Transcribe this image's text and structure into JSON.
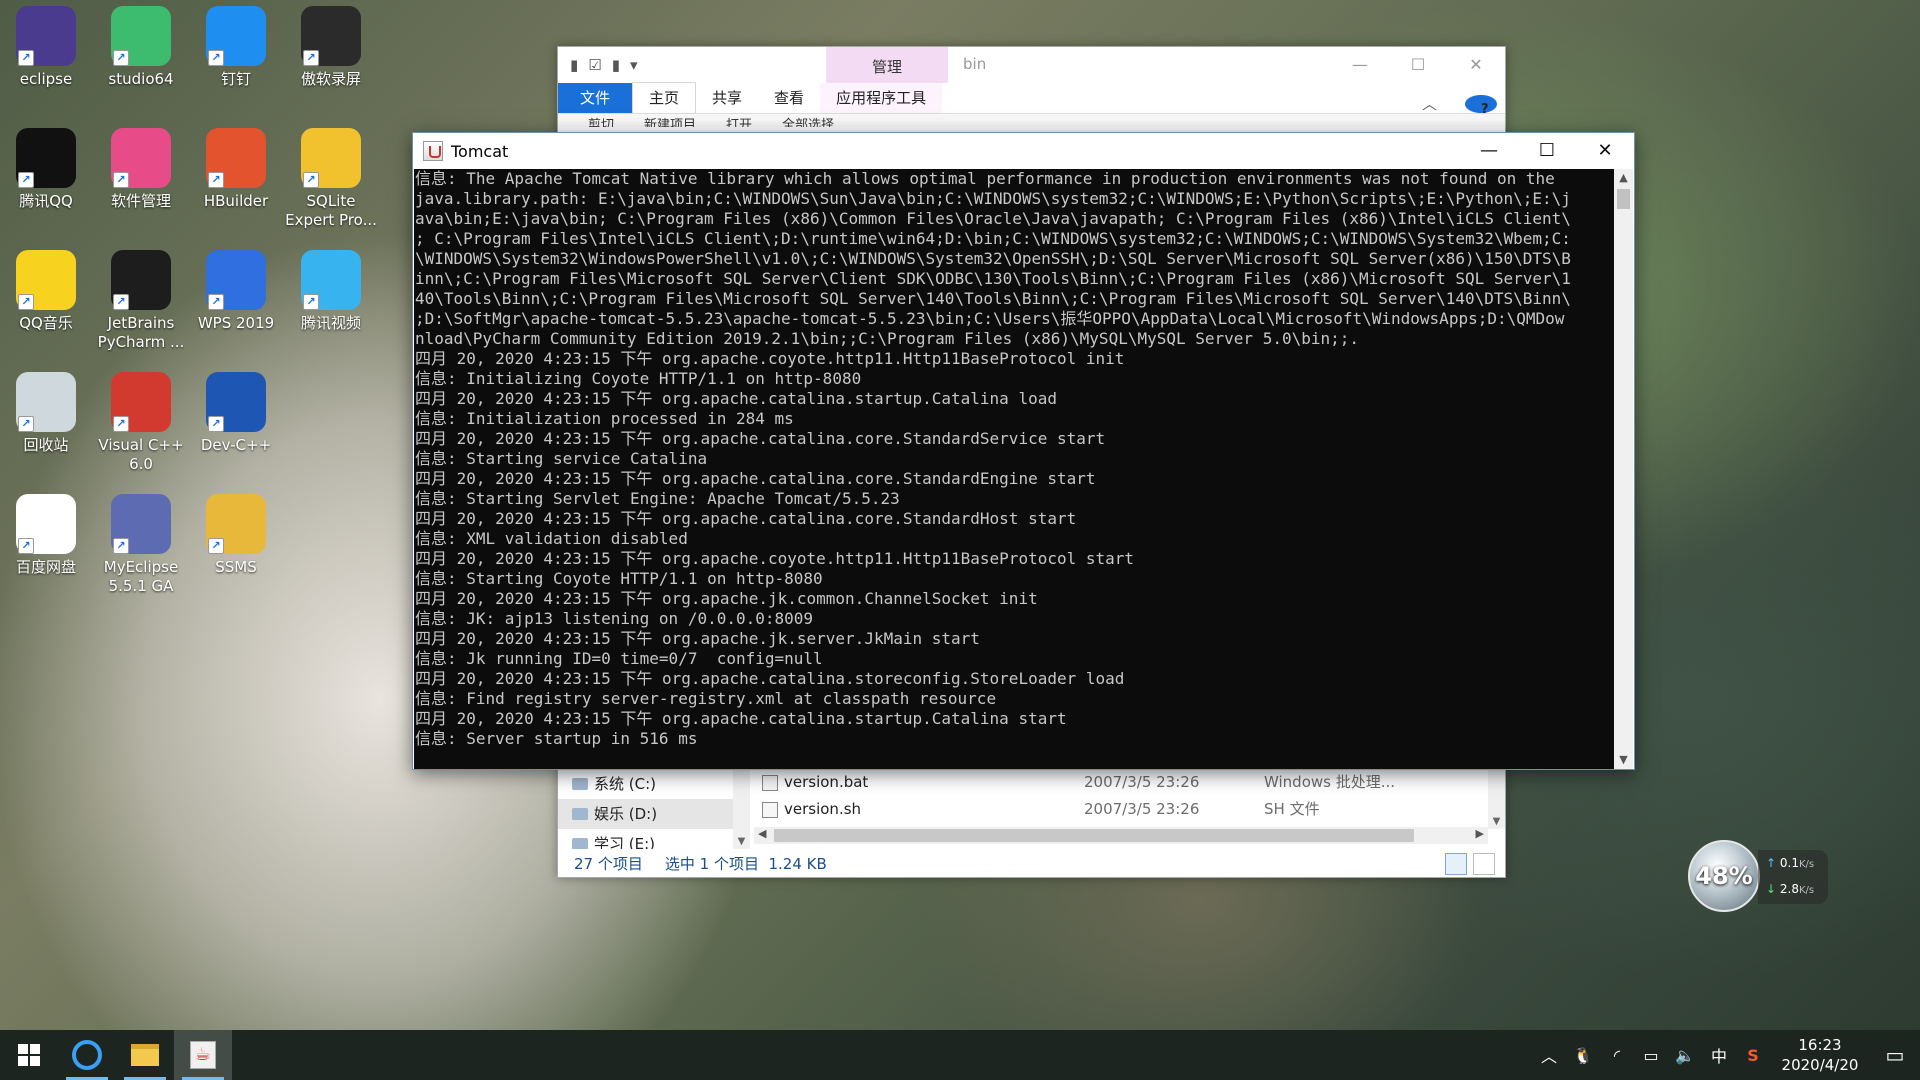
{
  "desktop_icons": [
    {
      "label": "eclipse",
      "icon": "eclipse-icon",
      "color": "#4a3b8f"
    },
    {
      "label": "studio64",
      "icon": "android-studio-icon",
      "color": "#3dbb6f"
    },
    {
      "label": "钉钉",
      "icon": "dingtalk-icon",
      "color": "#1f8ef1"
    },
    {
      "label": "傲软录屏",
      "icon": "screen-recorder-icon",
      "color": "#2b2b2b"
    },
    {
      "label": "腾讯QQ",
      "icon": "qq-icon",
      "color": "#111111"
    },
    {
      "label": "软件管理",
      "icon": "software-manager-icon",
      "color": "#e84c88"
    },
    {
      "label": "HBuilder",
      "icon": "hbuilder-icon",
      "color": "#e2532e"
    },
    {
      "label": "SQLite Expert Pro...",
      "icon": "sqlite-expert-icon",
      "color": "#f2c12e"
    },
    {
      "label": "QQ音乐",
      "icon": "qq-music-icon",
      "color": "#f7d21f"
    },
    {
      "label": "JetBrains PyCharm ...",
      "icon": "pycharm-icon",
      "color": "#1d1d1d"
    },
    {
      "label": "WPS 2019",
      "icon": "wps-icon",
      "color": "#2f6fe0"
    },
    {
      "label": "腾讯视频",
      "icon": "tencent-video-icon",
      "color": "#37b3f0"
    },
    {
      "label": "回收站",
      "icon": "recycle-bin-icon",
      "color": "#cfd8dc"
    },
    {
      "label": "Visual C++ 6.0",
      "icon": "visual-cpp-icon",
      "color": "#d33a2f"
    },
    {
      "label": "Dev-C++",
      "icon": "dev-cpp-icon",
      "color": "#1e56b3"
    },
    {
      "label": "百度网盘",
      "icon": "baidu-netdisk-icon",
      "color": "#ffffff"
    },
    {
      "label": "MyEclipse 5.5.1 GA",
      "icon": "myeclipse-icon",
      "color": "#5d6bb3"
    },
    {
      "label": "SSMS",
      "icon": "ssms-icon",
      "color": "#e8b83a"
    }
  ],
  "explorer": {
    "manage_tab": "管理",
    "folder_name": "bin",
    "tabs": [
      "文件",
      "主页",
      "共享",
      "查看",
      "应用程序工具"
    ],
    "ribbon_items": [
      "剪切",
      "新建项目",
      "打开",
      "全部选择"
    ],
    "nav_items": [
      "系统 (C:)",
      "娱乐 (D:)",
      "学习 (E:)"
    ],
    "files": [
      {
        "name": "version.bat",
        "date": "2007/3/5 23:26",
        "type": "Windows 批处理..."
      },
      {
        "name": "version.sh",
        "date": "2007/3/5 23:26",
        "type": "SH 文件"
      }
    ],
    "status": {
      "count": "27 个项目",
      "selected": "选中 1 个项目",
      "size": "1.24 KB"
    }
  },
  "tomcat": {
    "title": "Tomcat",
    "console_lines": [
      "信息: The Apache Tomcat Native library which allows optimal performance in production environments was not found on the",
      "java.library.path: E:\\java\\bin;C:\\WINDOWS\\Sun\\Java\\bin;C:\\WINDOWS\\system32;C:\\WINDOWS;E:\\Python\\Scripts\\;E:\\Python\\;E:\\j",
      "ava\\bin;E:\\java\\bin; C:\\Program Files (x86)\\Common Files\\Oracle\\Java\\javapath; C:\\Program Files (x86)\\Intel\\iCLS Client\\",
      "; C:\\Program Files\\Intel\\iCLS Client\\;D:\\runtime\\win64;D:\\bin;C:\\WINDOWS\\system32;C:\\WINDOWS;C:\\WINDOWS\\System32\\Wbem;C:",
      "\\WINDOWS\\System32\\WindowsPowerShell\\v1.0\\;C:\\WINDOWS\\System32\\OpenSSH\\;D:\\SQL Server\\Microsoft SQL Server(x86)\\150\\DTS\\B",
      "inn\\;C:\\Program Files\\Microsoft SQL Server\\Client SDK\\ODBC\\130\\Tools\\Binn\\;C:\\Program Files (x86)\\Microsoft SQL Server\\1",
      "40\\Tools\\Binn\\;C:\\Program Files\\Microsoft SQL Server\\140\\Tools\\Binn\\;C:\\Program Files\\Microsoft SQL Server\\140\\DTS\\Binn\\",
      ";D:\\SoftMgr\\apache-tomcat-5.5.23\\apache-tomcat-5.5.23\\bin;C:\\Users\\振华OPPO\\AppData\\Local\\Microsoft\\WindowsApps;D:\\QMDow",
      "nload\\PyCharm Community Edition 2019.2.1\\bin;;C:\\Program Files (x86)\\MySQL\\MySQL Server 5.0\\bin;;.",
      "四月 20, 2020 4:23:15 下午 org.apache.coyote.http11.Http11BaseProtocol init",
      "信息: Initializing Coyote HTTP/1.1 on http-8080",
      "四月 20, 2020 4:23:15 下午 org.apache.catalina.startup.Catalina load",
      "信息: Initialization processed in 284 ms",
      "四月 20, 2020 4:23:15 下午 org.apache.catalina.core.StandardService start",
      "信息: Starting service Catalina",
      "四月 20, 2020 4:23:15 下午 org.apache.catalina.core.StandardEngine start",
      "信息: Starting Servlet Engine: Apache Tomcat/5.5.23",
      "四月 20, 2020 4:23:15 下午 org.apache.catalina.core.StandardHost start",
      "信息: XML validation disabled",
      "四月 20, 2020 4:23:15 下午 org.apache.coyote.http11.Http11BaseProtocol start",
      "信息: Starting Coyote HTTP/1.1 on http-8080",
      "四月 20, 2020 4:23:15 下午 org.apache.jk.common.ChannelSocket init",
      "信息: JK: ajp13 listening on /0.0.0.0:8009",
      "四月 20, 2020 4:23:15 下午 org.apache.jk.server.JkMain start",
      "信息: Jk running ID=0 time=0/7  config=null",
      "四月 20, 2020 4:23:15 下午 org.apache.catalina.storeconfig.StoreLoader load",
      "信息: Find registry server-registry.xml at classpath resource",
      "四月 20, 2020 4:23:15 下午 org.apache.catalina.startup.Catalina start",
      "信息: Server startup in 516 ms"
    ]
  },
  "net_widget": {
    "percent": "48%",
    "upload": "0.1",
    "download": "2.8",
    "unit": "K/s"
  },
  "taskbar": {
    "apps": [
      "start-icon",
      "qq-browser-icon",
      "file-explorer-icon",
      "java-icon"
    ],
    "tray_ime": "中",
    "time": "16:23",
    "date": "2020/4/20"
  }
}
